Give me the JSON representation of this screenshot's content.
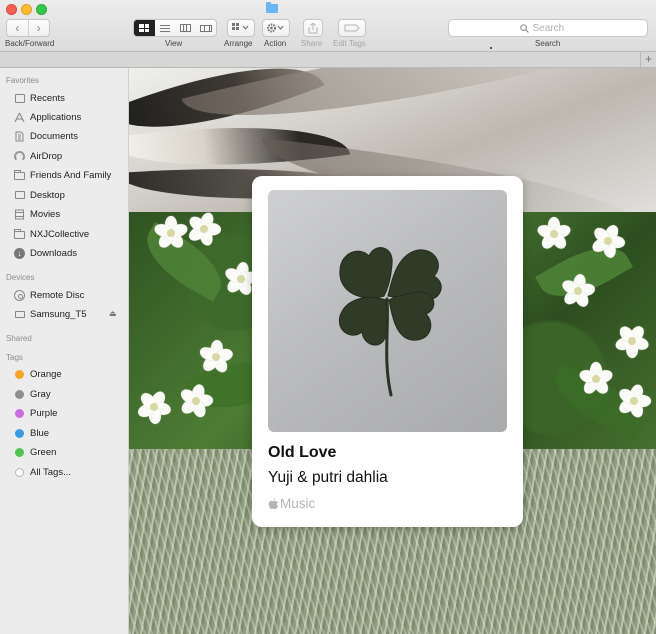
{
  "toolbar": {
    "nav_label": "Back/Forward",
    "back_glyph": "‹",
    "forward_glyph": "›",
    "view_label": "View",
    "arrange_label": "Arrange",
    "action_label": "Action",
    "share_label": "Share",
    "edit_tags_label": "Edit Tags",
    "search_label": "Search",
    "search_placeholder": "Search",
    "tab_add_glyph": "+"
  },
  "sidebar": {
    "favorites_heading": "Favorites",
    "favorites": [
      {
        "label": "Recents",
        "icon": "recents-icon"
      },
      {
        "label": "Applications",
        "icon": "applications-icon"
      },
      {
        "label": "Documents",
        "icon": "documents-icon"
      },
      {
        "label": "AirDrop",
        "icon": "airdrop-icon"
      },
      {
        "label": "Friends And Family",
        "icon": "folder-icon"
      },
      {
        "label": "Desktop",
        "icon": "desktop-icon"
      },
      {
        "label": "Movies",
        "icon": "movies-icon"
      },
      {
        "label": "NXJCollective",
        "icon": "folder-icon"
      },
      {
        "label": "Downloads",
        "icon": "downloads-icon"
      }
    ],
    "devices_heading": "Devices",
    "devices": [
      {
        "label": "Remote Disc",
        "icon": "disc-icon"
      },
      {
        "label": "Samsung_T5",
        "icon": "drive-icon"
      }
    ],
    "shared_heading": "Shared",
    "tags_heading": "Tags",
    "tags": [
      {
        "label": "Orange",
        "color": "#f5a623"
      },
      {
        "label": "Gray",
        "color": "#8e8e93"
      },
      {
        "label": "Purple",
        "color": "#c86ddb"
      },
      {
        "label": "Blue",
        "color": "#3b9ae1"
      },
      {
        "label": "Green",
        "color": "#4cc552"
      },
      {
        "label": "All Tags...",
        "color": "#ffffff"
      }
    ]
  },
  "music_card": {
    "title": "Old Love",
    "artist": "Yuji & putri dahlia",
    "service": "Music"
  }
}
